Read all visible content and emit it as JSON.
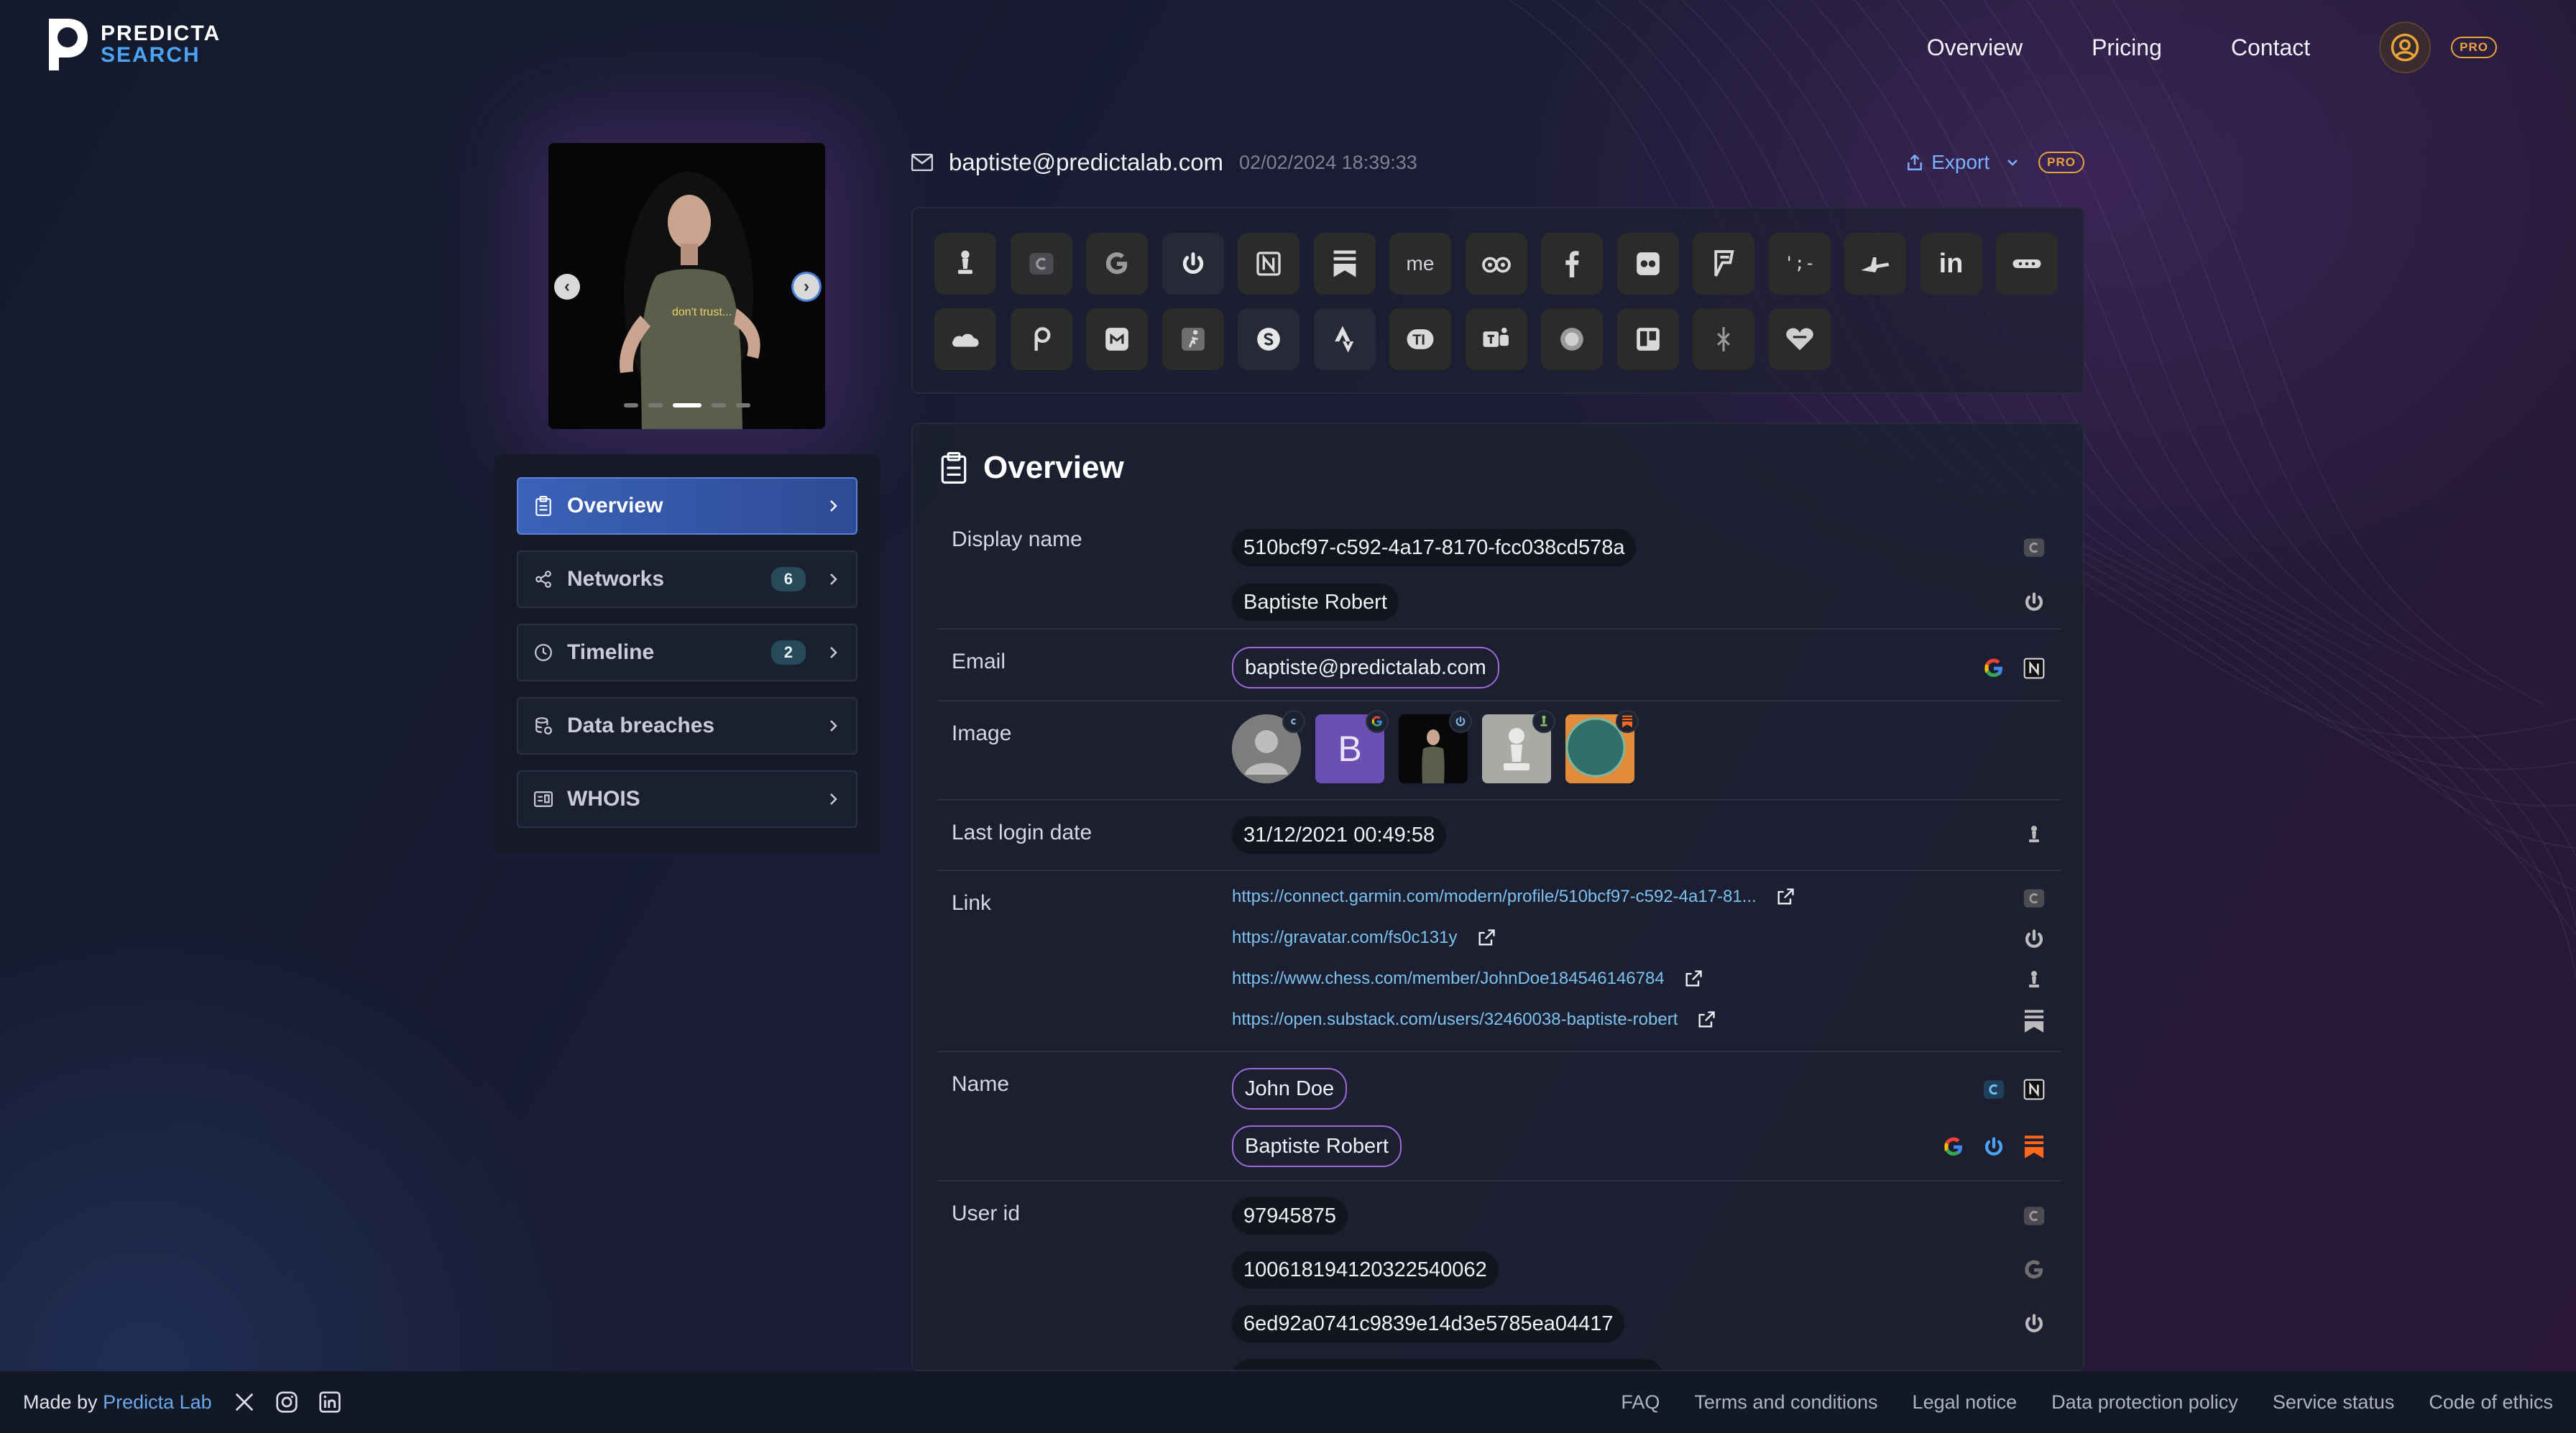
{
  "brand": {
    "line1": "PREDICTA",
    "line2": "SEARCH"
  },
  "nav": {
    "items": [
      "Overview",
      "Pricing",
      "Contact"
    ],
    "pro_badge": "PRO"
  },
  "profile": {
    "email": "baptiste@predictalab.com",
    "datetime": "02/02/2024 18:39:33",
    "photo_shirt_text": "don't trust..."
  },
  "export": {
    "label": "Export",
    "pro_badge": "PRO"
  },
  "menu": {
    "items": [
      {
        "label": "Overview",
        "badge": ""
      },
      {
        "label": "Networks",
        "badge": "6"
      },
      {
        "label": "Timeline",
        "badge": "2"
      },
      {
        "label": "Data breaches",
        "badge": ""
      },
      {
        "label": "WHOIS",
        "badge": ""
      }
    ]
  },
  "network_icons": {
    "row1": [
      "chess-icon",
      "garmin-icon",
      "google-icon",
      "gravatar-icon",
      "notion-icon",
      "substack-icon",
      "me-icon",
      "tripadvisor-icon",
      "facebook-icon",
      "flickr-icon",
      "foursquare-icon",
      "codeproject-icon",
      "airliner-icon",
      "linkedin-icon",
      "more-icon"
    ],
    "row2": [
      "cloud-icon",
      "picsart-icon",
      "mastodon-icon",
      "runner-icon",
      "skype-icon",
      "strava-icon",
      "typeform-icon",
      "teams-icon",
      "circle-icon",
      "trello-icon",
      "tinder-icon",
      "heart-icon"
    ],
    "me_text": "me",
    "linkedin_text": "in"
  },
  "overview": {
    "title": "Overview",
    "display_name": {
      "label": "Display name",
      "values": [
        "510bcf97-c592-4a17-8170-fcc038cd578a",
        "Baptiste Robert"
      ]
    },
    "email": {
      "label": "Email",
      "value": "baptiste@predictalab.com"
    },
    "image": {
      "label": "Image",
      "avatar_letter": "B"
    },
    "last_login": {
      "label": "Last login date",
      "value": "31/12/2021 00:49:58"
    },
    "link": {
      "label": "Link",
      "values": [
        "https://connect.garmin.com/modern/profile/510bcf97-c592-4a17-81...",
        "https://gravatar.com/fs0c131y",
        "https://www.chess.com/member/JohnDoe184546146784",
        "https://open.substack.com/users/32460038-baptiste-robert"
      ]
    },
    "name": {
      "label": "Name",
      "values": [
        "John Doe",
        "Baptiste Robert"
      ]
    },
    "user_id": {
      "label": "User id",
      "values": [
        "97945875",
        "100618194120322540062",
        "6ed92a0741c9839e14d3e5785ea04417"
      ]
    }
  },
  "footer": {
    "made_by": "Made by",
    "made_by_link": "Predicta Lab",
    "links": [
      "FAQ",
      "Terms and conditions",
      "Legal notice",
      "Data protection policy",
      "Service status",
      "Code of ethics"
    ]
  },
  "colors": {
    "accent_blue": "#4aa3f5",
    "pro_orange": "#e8a33a",
    "chip_outline": "#9b6ad8",
    "link": "#7cc1ee"
  }
}
